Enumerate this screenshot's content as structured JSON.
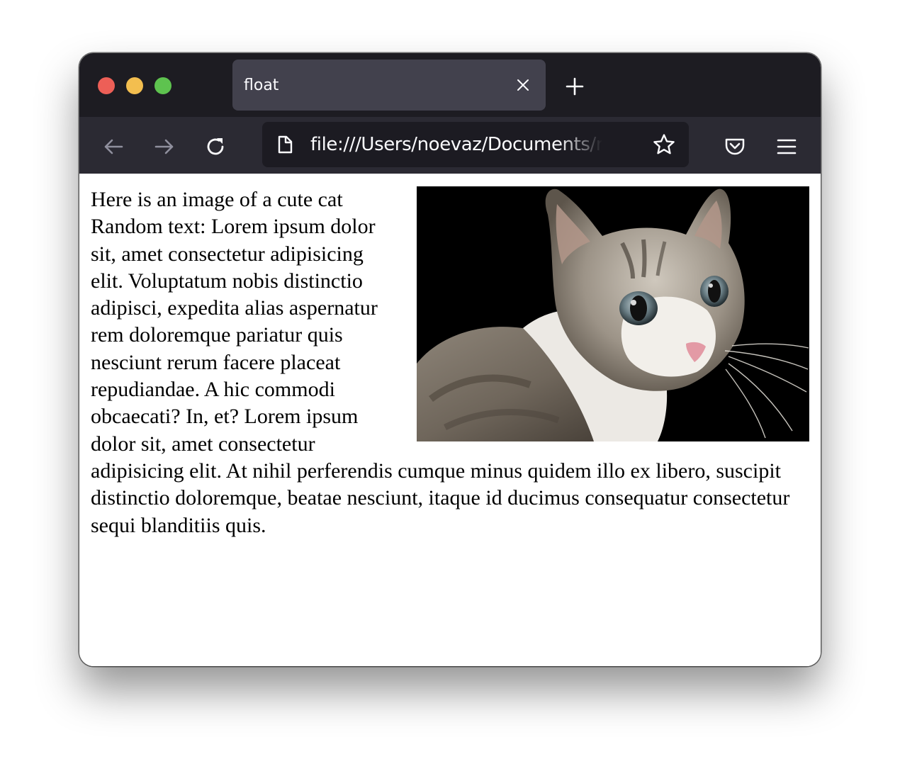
{
  "browser": {
    "tab": {
      "title": "float",
      "close_icon": "close-icon"
    },
    "new_tab_icon": "plus-icon",
    "nav": {
      "back_icon": "arrow-left-icon",
      "forward_icon": "arrow-right-icon",
      "reload_icon": "reload-icon"
    },
    "urlbar": {
      "page_icon": "document-icon",
      "url": "file:///Users/noevaz/Documents/repos",
      "bookmark_icon": "star-icon"
    },
    "toolbar": {
      "pocket_icon": "pocket-icon",
      "menu_icon": "hamburger-menu-icon"
    },
    "colors": {
      "tabbar": "#1d1c22",
      "navbar": "#2b2a33",
      "active_tab": "#42414d",
      "urlbar": "#1c1b22",
      "close": "#ed5f57",
      "minimize": "#f3be4f",
      "maximize": "#5ec34f"
    }
  },
  "page": {
    "heading_line": "Here is an image of a cute cat",
    "body_text": "Random text: Lorem ipsum dolor sit, amet consectetur adipisicing elit. Voluptatum nobis distinctio adipisci, expedita alias aspernatur rem doloremque pariatur quis nesciunt rerum facere placeat repudiandae. A hic commodi obcaecati? In, et? Lorem ipsum dolor sit, amet consectetur adipisicing elit. At nihil perferendis cumque minus quidem illo ex libero, suscipit distinctio doloremque, beatae nesciunt, itaque id ducimus consequatur consectetur sequi blanditiis quis.",
    "image": {
      "subject": "cat",
      "float": "right"
    }
  }
}
